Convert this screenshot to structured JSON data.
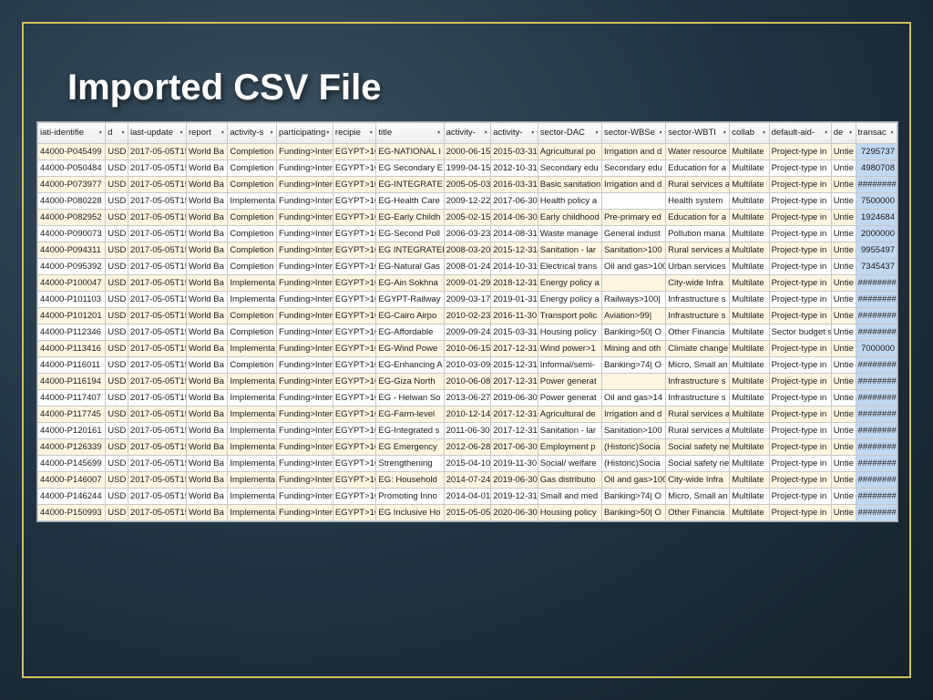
{
  "title": "Imported CSV File",
  "headers": [
    "iati-identifie",
    "d",
    "last-update",
    "report",
    "activity-s",
    "participating",
    "recipie",
    "title",
    "activity-",
    "activity-",
    "sector-DAC",
    "sector-WBSe",
    "sector-WBTI",
    "collab",
    "default-aid-",
    "de",
    "transac"
  ],
  "rows": [
    [
      "44000-P045499",
      "USD",
      "2017-05-05T15:",
      "World Ba",
      "Completion",
      "Funding>Intern",
      "EGYPT>10",
      "EG-NATIONAL I",
      "2000-06-15",
      "2015-03-31",
      "Agricultural po",
      "Irrigation and d",
      "Water resource",
      "Multilate",
      "Project-type in",
      "Untie",
      "7295737"
    ],
    [
      "44000-P050484",
      "USD",
      "2017-05-05T15:",
      "World Ba",
      "Completion",
      "Funding>Intern",
      "EGYPT>10",
      "EG Secondary E",
      "1999-04-15",
      "2012-10-31",
      "Secondary edu",
      "Secondary edu",
      "Education for a",
      "Multilate",
      "Project-type in",
      "Untie",
      "4980708"
    ],
    [
      "44000-P073977",
      "USD",
      "2017-05-05T15:",
      "World Ba",
      "Completion",
      "Funding>Intern",
      "EGYPT>10",
      "EG-INTEGRATE",
      "2005-05-03",
      "2016-03-31",
      "Basic sanitation",
      "Irrigation and d",
      "Rural services a",
      "Multilate",
      "Project-type in",
      "Untie",
      "########"
    ],
    [
      "44000-P080228",
      "USD",
      "2017-05-05T15:",
      "World Ba",
      "Implementa",
      "Funding>Intern",
      "EGYPT>10",
      "EG-Health Care",
      "2009-12-22",
      "2017-06-30",
      "Health policy a",
      "",
      "Health system",
      "Multilate",
      "Project-type in",
      "Untie",
      "7500000"
    ],
    [
      "44000-P082952",
      "USD",
      "2017-05-05T15:",
      "World Ba",
      "Completion",
      "Funding>Intern",
      "EGYPT>10",
      "EG-Early Childh",
      "2005-02-15",
      "2014-06-30",
      "Early childhood",
      "Pre-primary ed",
      "Education for a",
      "Multilate",
      "Project-type in",
      "Untie",
      "1924684"
    ],
    [
      "44000-P090073",
      "USD",
      "2017-05-05T15:",
      "World Ba",
      "Completion",
      "Funding>Intern",
      "EGYPT>10",
      "EG-Second Poll",
      "2006-03-23",
      "2014-08-31",
      "Waste manage",
      "General indust",
      "Pollution mana",
      "Multilate",
      "Project-type in",
      "Untie",
      "2000000"
    ],
    [
      "44000-P094311",
      "USD",
      "2017-05-05T15:",
      "World Ba",
      "Completion",
      "Funding>Intern",
      "EGYPT>10",
      "EG INTEGRATED",
      "2008-03-20",
      "2015-12-31",
      "Sanitation - lar",
      "Sanitation>100",
      "Rural services a",
      "Multilate",
      "Project-type in",
      "Untie",
      "9955497"
    ],
    [
      "44000-P095392",
      "USD",
      "2017-05-05T15:",
      "World Ba",
      "Completion",
      "Funding>Intern",
      "EGYPT>10",
      "EG-Natural Gas",
      "2008-01-24",
      "2014-10-31",
      "Electrical trans",
      "Oil and gas>100",
      "Urban services",
      "Multilate",
      "Project-type in",
      "Untie",
      "7345437"
    ],
    [
      "44000-P100047",
      "USD",
      "2017-05-05T15:",
      "World Ba",
      "Implementa",
      "Funding>Intern",
      "EGYPT>10",
      "EG-Ain Sokhna",
      "2009-01-29",
      "2018-12-31",
      "Energy policy a",
      "",
      "City-wide Infra",
      "Multilate",
      "Project-type in",
      "Untie",
      "########"
    ],
    [
      "44000-P101103",
      "USD",
      "2017-05-05T15:",
      "World Ba",
      "Implementa",
      "Funding>Intern",
      "EGYPT>10",
      "EGYPT-Railway",
      "2009-03-17",
      "2019-01-31",
      "Energy policy a",
      "Railways>100|",
      "Infrastructure s",
      "Multilate",
      "Project-type in",
      "Untie",
      "########"
    ],
    [
      "44000-P101201",
      "USD",
      "2017-05-05T15:",
      "World Ba",
      "Completion",
      "Funding>Intern",
      "EGYPT>10",
      "EG-Cairo Airpo",
      "2010-02-23",
      "2016-11-30",
      "Transport polic",
      "Aviation>99|",
      "Infrastructure s",
      "Multilate",
      "Project-type in",
      "Untie",
      "########"
    ],
    [
      "44000-P112346",
      "USD",
      "2017-05-05T15:",
      "World Ba",
      "Completion",
      "Funding>Intern",
      "EGYPT>10",
      "EG-Affordable",
      "2009-09-24",
      "2015-03-31",
      "Housing policy",
      "Banking>50| O",
      "Other Financia",
      "Multilate",
      "Sector budget s",
      "Untie",
      "########"
    ],
    [
      "44000-P113416",
      "USD",
      "2017-05-05T15:",
      "World Ba",
      "Implementa",
      "Funding>Intern",
      "EGYPT>10",
      "EG-Wind Powe",
      "2010-06-15",
      "2017-12-31",
      "Wind power>1",
      "Mining and oth",
      "Climate change",
      "Multilate",
      "Project-type in",
      "Untie",
      "7000000"
    ],
    [
      "44000-P116011",
      "USD",
      "2017-05-05T15:",
      "World Ba",
      "Completion",
      "Funding>Intern",
      "EGYPT>10",
      "EG-Enhancing A",
      "2010-03-09",
      "2015-12-31",
      "Informal/semi-",
      "Banking>74| O",
      "Micro, Small an",
      "Multilate",
      "Project-type in",
      "Untie",
      "########"
    ],
    [
      "44000-P116194",
      "USD",
      "2017-05-05T15:",
      "World Ba",
      "Implementa",
      "Funding>Intern",
      "EGYPT>10",
      "EG-Giza North",
      "2010-06-08",
      "2017-12-31",
      "Power generat",
      "",
      "Infrastructure s",
      "Multilate",
      "Project-type in",
      "Untie",
      "########"
    ],
    [
      "44000-P117407",
      "USD",
      "2017-05-05T15:",
      "World Ba",
      "Implementa",
      "Funding>Intern",
      "EGYPT>10",
      "EG - Helwan So",
      "2013-06-27",
      "2019-06-30",
      "Power generat",
      "Oil and gas>14",
      "Infrastructure s",
      "Multilate",
      "Project-type in",
      "Untie",
      "########"
    ],
    [
      "44000-P117745",
      "USD",
      "2017-05-05T15:",
      "World Ba",
      "Implementa",
      "Funding>Intern",
      "EGYPT>10",
      "EG-Farm-level",
      "2010-12-14",
      "2017-12-31",
      "Agricultural de",
      "Irrigation and d",
      "Rural services a",
      "Multilate",
      "Project-type in",
      "Untie",
      "########"
    ],
    [
      "44000-P120161",
      "USD",
      "2017-05-05T15:",
      "World Ba",
      "Implementa",
      "Funding>Intern",
      "EGYPT>10",
      "EG-Integrated s",
      "2011-06-30",
      "2017-12-31",
      "Sanitation - lar",
      "Sanitation>100",
      "Rural services a",
      "Multilate",
      "Project-type in",
      "Untie",
      "########"
    ],
    [
      "44000-P126339",
      "USD",
      "2017-05-05T15:",
      "World Ba",
      "Implementa",
      "Funding>Intern",
      "EGYPT>10",
      "EG Emergency",
      "2012-06-28",
      "2017-06-30",
      "Employment p",
      "(Historic)Socia",
      "Social safety ne",
      "Multilate",
      "Project-type in",
      "Untie",
      "########"
    ],
    [
      "44000-P145699",
      "USD",
      "2017-05-05T15:",
      "World Ba",
      "Implementa",
      "Funding>Intern",
      "EGYPT>10",
      "Strengthening",
      "2015-04-10",
      "2019-11-30",
      "Social/ welfare",
      "(Historic)Socia",
      "Social safety ne",
      "Multilate",
      "Project-type in",
      "Untie",
      "########"
    ],
    [
      "44000-P146007",
      "USD",
      "2017-05-05T15:",
      "World Ba",
      "Implementa",
      "Funding>Intern",
      "EGYPT>10",
      "EG: Household",
      "2014-07-24",
      "2019-06-30",
      "Gas distributio",
      "Oil and gas>100",
      "City-wide Infra",
      "Multilate",
      "Project-type in",
      "Untie",
      "########"
    ],
    [
      "44000-P146244",
      "USD",
      "2017-05-05T15:",
      "World Ba",
      "Implementa",
      "Funding>Intern",
      "EGYPT>10",
      "Promoting Inno",
      "2014-04-01",
      "2019-12-31",
      "Small and med",
      "Banking>74| O",
      "Micro, Small an",
      "Multilate",
      "Project-type in",
      "Untie",
      "########"
    ],
    [
      "44000-P150993",
      "USD",
      "2017-05-05T15:",
      "World Ba",
      "Implementa",
      "Funding>Intern",
      "EGYPT>10",
      "EG Inclusive Ho",
      "2015-05-05",
      "2020-06-30",
      "Housing policy",
      "Banking>50| O",
      "Other Financia",
      "Multilate",
      "Project-type in",
      "Untie",
      "########"
    ]
  ]
}
